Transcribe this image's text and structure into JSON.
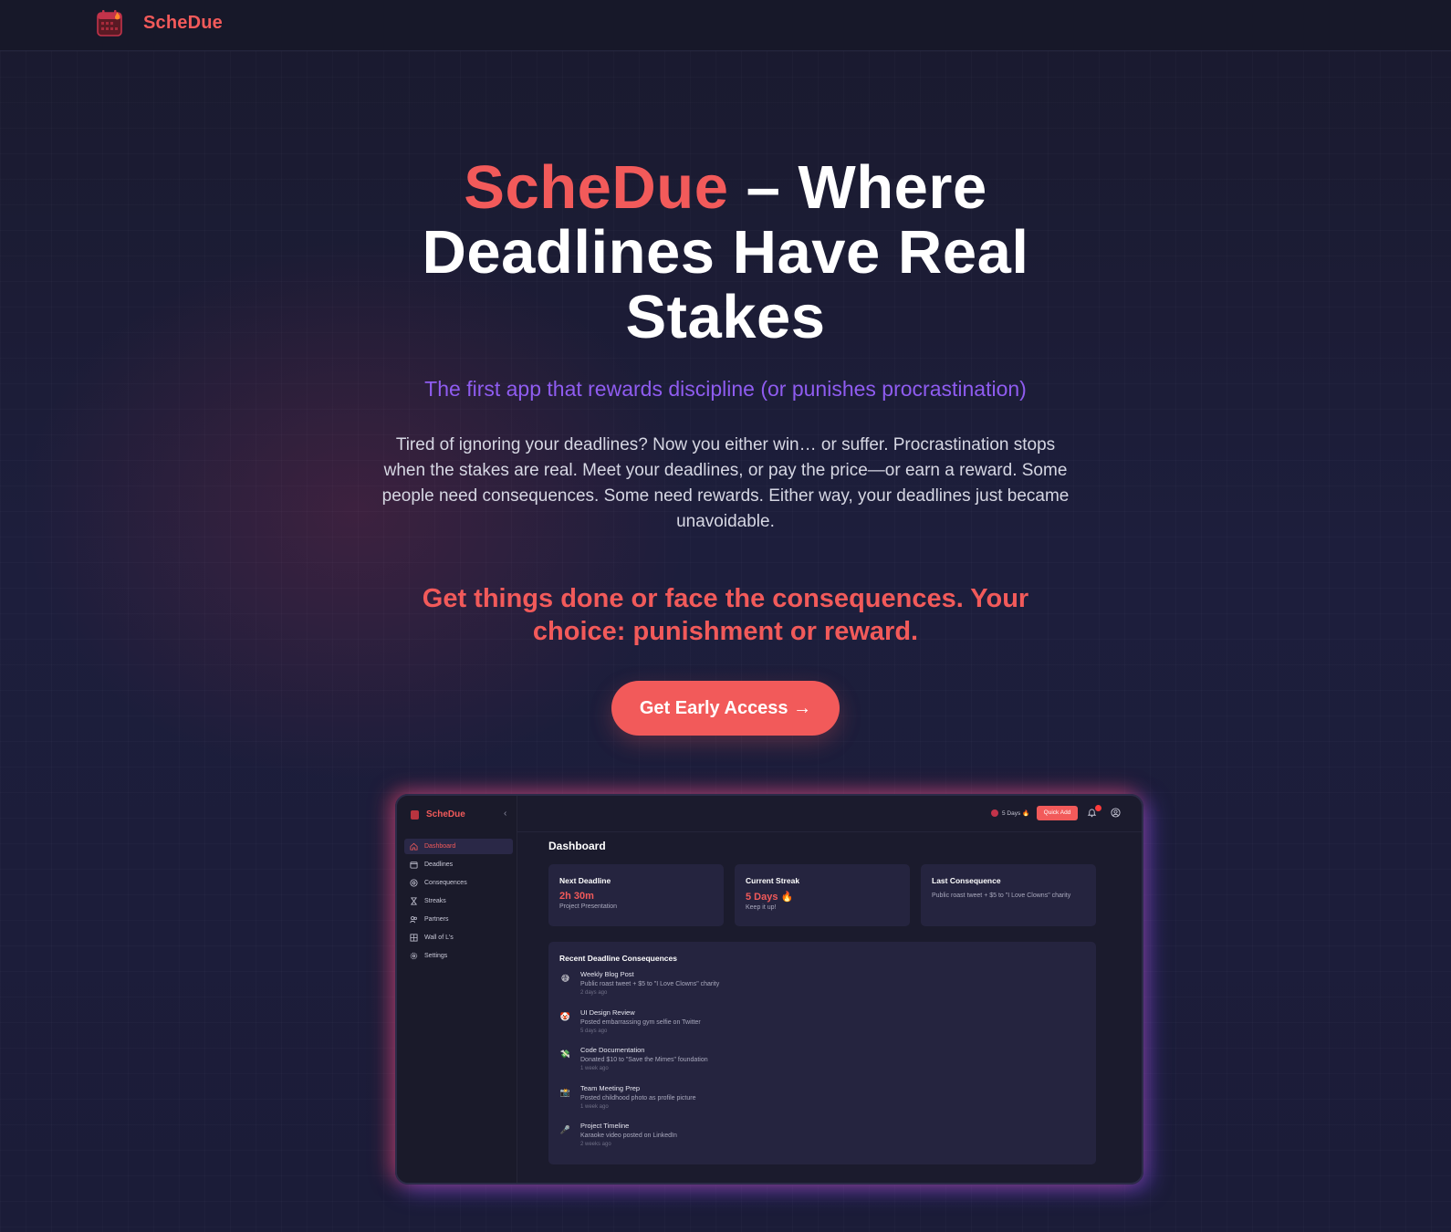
{
  "nav": {
    "brand": "ScheDue"
  },
  "hero": {
    "title_accent": "ScheDue",
    "title_rest": " – Where Deadlines Have Real Stakes",
    "subtitle": "The first app that rewards discipline (or punishes procrastination)",
    "description": "Tired of ignoring your deadlines? Now you either win… or suffer. Procrastination stops when the stakes are real. Meet your deadlines, or pay the price—or earn a reward. Some people need consequences. Some need rewards. Either way, your deadlines just became unavoidable.",
    "tagline": "Get things done or face the consequences. Your choice: punishment or reward.",
    "cta_label": "Get Early Access →"
  },
  "preview": {
    "brand": "ScheDue",
    "collapse_icon": "‹",
    "sidebar": [
      {
        "label": "Dashboard",
        "icon": "home-icon"
      },
      {
        "label": "Deadlines",
        "icon": "calendar-icon"
      },
      {
        "label": "Consequences",
        "icon": "target-icon"
      },
      {
        "label": "Streaks",
        "icon": "hourglass-icon"
      },
      {
        "label": "Partners",
        "icon": "users-icon"
      },
      {
        "label": "Wall of L's",
        "icon": "wall-icon"
      },
      {
        "label": "Settings",
        "icon": "gear-icon"
      }
    ],
    "topbar": {
      "streak": "5 Days 🔥",
      "quick_add": "Quick Add"
    },
    "main_title": "Dashboard",
    "cards": {
      "next_deadline": {
        "label": "Next Deadline",
        "value": "2h 30m",
        "sub": "Project Presentation"
      },
      "current_streak": {
        "label": "Current Streak",
        "value": "5 Days 🔥",
        "sub": "Keep it up!"
      },
      "last_consequence": {
        "label": "Last Consequence",
        "text": "Public roast tweet + $5 to \"I Love Clowns\" charity"
      }
    },
    "recent": {
      "title": "Recent Deadline Consequences",
      "items": [
        {
          "emoji": "😅",
          "title": "Weekly Blog Post",
          "desc": "Public roast tweet + $5 to \"I Love Clowns\" charity",
          "time": "2 days ago"
        },
        {
          "emoji": "🤡",
          "title": "UI Design Review",
          "desc": "Posted embarrassing gym selfie on Twitter",
          "time": "5 days ago"
        },
        {
          "emoji": "💸",
          "title": "Code Documentation",
          "desc": "Donated $10 to \"Save the Mimes\" foundation",
          "time": "1 week ago"
        },
        {
          "emoji": "📸",
          "title": "Team Meeting Prep",
          "desc": "Posted childhood photo as profile picture",
          "time": "1 week ago"
        },
        {
          "emoji": "🎤",
          "title": "Project Timeline",
          "desc": "Karaoke video posted on LinkedIn",
          "time": "2 weeks ago"
        }
      ]
    }
  },
  "colors": {
    "accent": "#f25a5a",
    "purple": "#8f5cf0",
    "background": "#1b1c35"
  }
}
